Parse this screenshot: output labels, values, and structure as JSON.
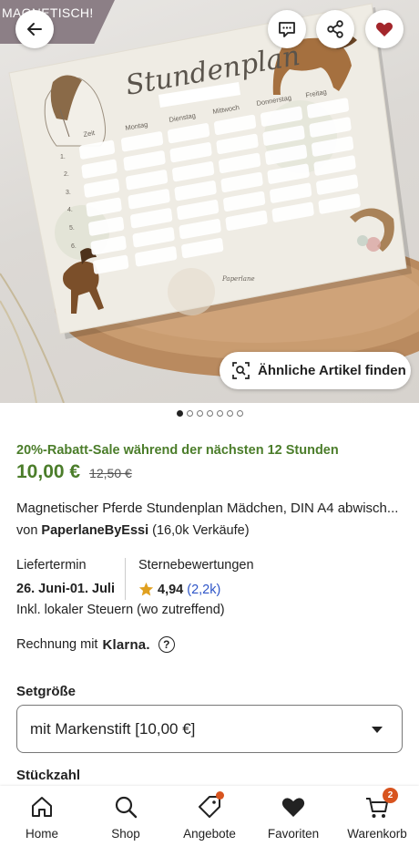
{
  "hero": {
    "ribbon_text": "MAGNETISCH!",
    "similar_button": "Ähnliche Artikel finden",
    "image_count": 7,
    "active_image": 1,
    "poster": {
      "title": "Stundenplan",
      "days": [
        "Zeit",
        "Montag",
        "Dienstag",
        "Mittwoch",
        "Donnerstag",
        "Freitag"
      ],
      "rows": [
        "1.",
        "2.",
        "3.",
        "4.",
        "5.",
        "6."
      ],
      "brand": "Paperlane"
    }
  },
  "product": {
    "sale_text": "20%-Rabatt-Sale während der nächsten 12 Stunden",
    "price": "10,00 €",
    "old_price": "12,50 €",
    "title": "Magnetischer Pferde Stundenplan Mädchen, DIN A4 abwisch...",
    "seller_prefix": "von",
    "seller_name": "PaperlaneByEssi",
    "seller_sales": "(16,0k Verkäufe)",
    "delivery_label": "Liefertermin",
    "delivery_value": "26. Juni-01. Juli",
    "rating_label": "Sternebewertungen",
    "rating_value": "4,94",
    "rating_count": "(2,2k)",
    "tax_note": "Inkl. lokaler Steuern (wo zutreffend)",
    "klarna_prefix": "Rechnung mit",
    "klarna_brand": "Klarna.",
    "set_label": "Setgröße",
    "set_selected": "mit Markenstift [10,00 €]",
    "qty_label": "Stückzahl"
  },
  "nav": {
    "items": [
      {
        "label": "Home",
        "icon": "home-icon"
      },
      {
        "label": "Shop",
        "icon": "search-icon"
      },
      {
        "label": "Angebote",
        "icon": "tag-icon"
      },
      {
        "label": "Favoriten",
        "icon": "heart-icon"
      },
      {
        "label": "Warenkorb",
        "icon": "cart-icon"
      }
    ],
    "cart_count": "2"
  },
  "colors": {
    "sale_green": "#4b7d2a",
    "favorite_red": "#a3262b",
    "badge_orange": "#d8541f",
    "link_blue": "#2f56c8"
  }
}
